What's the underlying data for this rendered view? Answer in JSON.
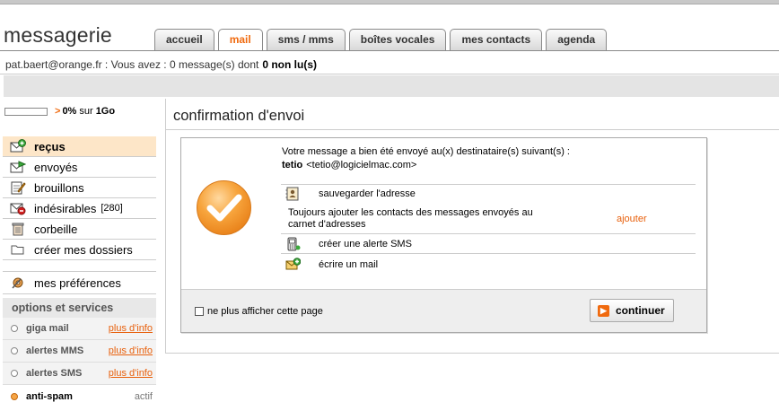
{
  "app": {
    "title": "messagerie"
  },
  "tabs": [
    {
      "label": "accueil",
      "active": false
    },
    {
      "label": "mail",
      "active": true
    },
    {
      "label": "sms /  mms",
      "active": false
    },
    {
      "label": "boîtes vocales",
      "active": false
    },
    {
      "label": "mes contacts",
      "active": false
    },
    {
      "label": "agenda",
      "active": false
    }
  ],
  "status": {
    "text": "pat.baert@orange.fr : Vous avez : 0 message(s) dont",
    "unread": "0 non lu(s)"
  },
  "quota": {
    "arrow": ">",
    "percent": "0%",
    "sur": "sur",
    "total": "1Go",
    "fraction": 0
  },
  "folders": [
    {
      "label": "reçus",
      "icon": "inbox-icon",
      "active": true,
      "count": ""
    },
    {
      "label": "envoyés",
      "icon": "sent-icon",
      "active": false,
      "count": ""
    },
    {
      "label": "brouillons",
      "icon": "drafts-icon",
      "active": false,
      "count": ""
    },
    {
      "label": "indésirables",
      "icon": "spam-icon",
      "active": false,
      "count": "[280]"
    },
    {
      "label": "corbeille",
      "icon": "trash-icon",
      "active": false,
      "count": ""
    },
    {
      "label": "créer mes dossiers",
      "icon": "folder-icon",
      "active": false,
      "count": ""
    }
  ],
  "preferences": {
    "label": "mes préférences"
  },
  "options": {
    "title": "options et services",
    "items": [
      {
        "name": "giga mail",
        "link": "plus d'info"
      },
      {
        "name": "alertes MMS",
        "link": "plus d'info"
      },
      {
        "name": "alertes SMS",
        "link": "plus d'info"
      }
    ],
    "antispam": {
      "name": "anti-spam",
      "status": "actif"
    }
  },
  "main": {
    "title": "confirmation d'envoi",
    "message": "Votre message a bien été envoyé au(x) destinataire(s) suivant(s) :",
    "recipient_name": "tetio",
    "recipient_email": "<tetio@logicielmac.com>",
    "actions": {
      "save_address": "sauvegarder l'adresse",
      "sms_alert": "créer une alerte SMS",
      "write_mail": "écrire un mail"
    },
    "note": "Toujours ajouter les contacts des messages envoyés au carnet d'adresses",
    "add_link": "ajouter",
    "checkbox_label": "ne plus afficher cette page",
    "continue_label": "continuer"
  },
  "colors": {
    "accent": "#f06a0f",
    "active_folder_bg": "#fde6c8",
    "link": "#e8600c"
  }
}
